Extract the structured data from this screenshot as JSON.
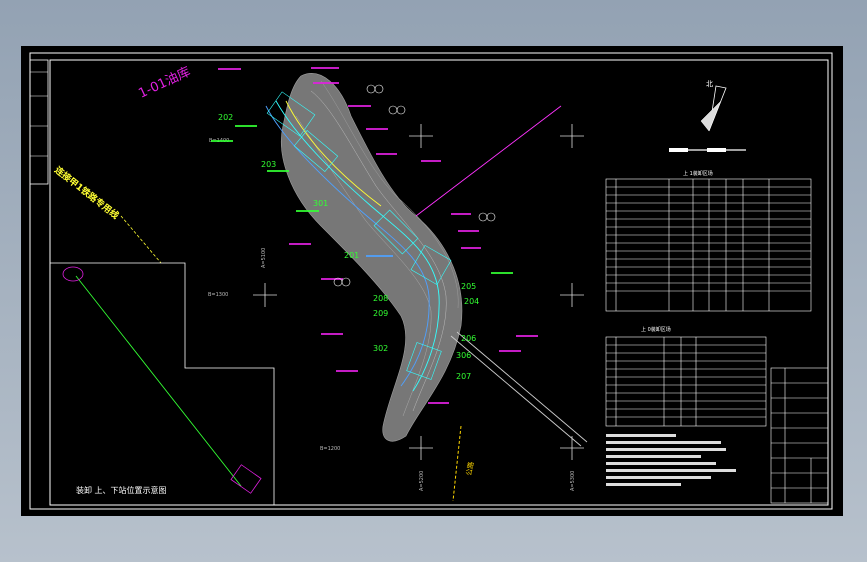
{
  "drawing": {
    "title_label": "1-01油库",
    "road_label": "连接甲1铁路专用线",
    "left_vertical_label": "公路",
    "inset_caption": "装卸 上、下站位置示意图",
    "north_label": "北",
    "table1_title": "上 1装卸区场",
    "table2_title": "上 0装卸区场",
    "numbers": [
      "202",
      "203",
      "301",
      "201",
      "208",
      "209",
      "302",
      "206",
      "207",
      "204",
      "205",
      "306"
    ],
    "colors": {
      "border": "#ffffff",
      "terrain": "#8a8a8a",
      "alignment": "#4ea1ff",
      "magenta": "#e020e0",
      "green": "#33ff33",
      "yellow": "#ffff33",
      "cyan": "#33ffff"
    }
  }
}
